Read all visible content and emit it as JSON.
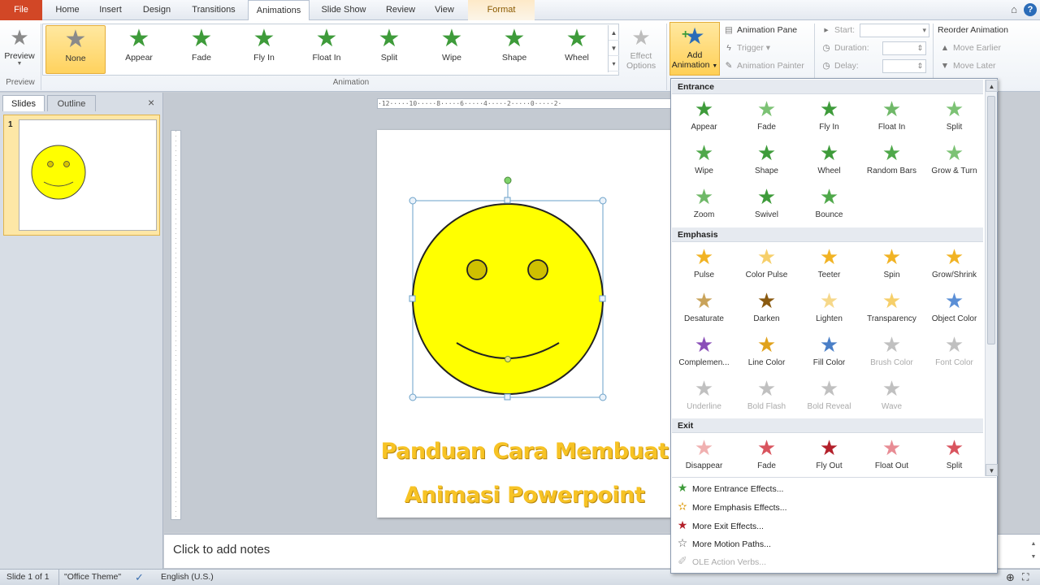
{
  "tabs": {
    "file": "File",
    "home": "Home",
    "insert": "Insert",
    "design": "Design",
    "transitions": "Transitions",
    "animations": "Animations",
    "slide_show": "Slide Show",
    "review": "Review",
    "view": "View",
    "format": "Format"
  },
  "ribbon": {
    "preview": "Preview",
    "preview_group": "Preview",
    "animation_group": "Animation",
    "gallery": [
      {
        "label": "None",
        "icon": "star-gray-icon"
      },
      {
        "label": "Appear",
        "icon": "star-green-icon"
      },
      {
        "label": "Fade",
        "icon": "star-green-icon"
      },
      {
        "label": "Fly In",
        "icon": "star-green-icon"
      },
      {
        "label": "Float In",
        "icon": "star-green-icon"
      },
      {
        "label": "Split",
        "icon": "star-green-icon"
      },
      {
        "label": "Wipe",
        "icon": "star-green-icon"
      },
      {
        "label": "Shape",
        "icon": "star-green-icon"
      },
      {
        "label": "Wheel",
        "icon": "star-green-icon"
      }
    ],
    "effect_options": "Effect Options",
    "add_animation_line1": "Add",
    "add_animation_line2": "Animation",
    "animation_pane": "Animation Pane",
    "trigger": "Trigger",
    "animation_painter": "Animation Painter",
    "start": "Start:",
    "duration": "Duration:",
    "delay": "Delay:",
    "reorder": "Reorder Animation",
    "move_earlier": "Move Earlier",
    "move_later": "Move Later"
  },
  "slides_pane": {
    "tab_slides": "Slides",
    "tab_outline": "Outline",
    "close": "×",
    "slide_number": "1"
  },
  "ruler_text": "·12·····10·····8·····6·····4·····2·····0·····2·",
  "slide": {
    "caption_line1": "Panduan Cara Membuat",
    "caption_line2": "Animasi Powerpoint"
  },
  "notes_placeholder": "Click to add notes",
  "statusbar": {
    "slide_info": "Slide 1 of 1",
    "theme": "\"Office Theme\"",
    "language": "English (U.S.)"
  },
  "dropdown": {
    "entrance_label": "Entrance",
    "emphasis_label": "Emphasis",
    "exit_label": "Exit",
    "entrance": [
      {
        "label": "Appear",
        "color": "#3e9b3a"
      },
      {
        "label": "Fade",
        "color": "#7cc274"
      },
      {
        "label": "Fly In",
        "color": "#3e9b3a"
      },
      {
        "label": "Float In",
        "color": "#6fb868"
      },
      {
        "label": "Split",
        "color": "#7cc274"
      },
      {
        "label": "Wipe",
        "color": "#4fa84a"
      },
      {
        "label": "Shape",
        "color": "#3e9b3a"
      },
      {
        "label": "Wheel",
        "color": "#3e9b3a"
      },
      {
        "label": "Random Bars",
        "color": "#4fa84a"
      },
      {
        "label": "Grow & Turn",
        "color": "#7cc274"
      },
      {
        "label": "Zoom",
        "color": "#6fb868"
      },
      {
        "label": "Swivel",
        "color": "#3e9b3a"
      },
      {
        "label": "Bounce",
        "color": "#4fa84a"
      }
    ],
    "emphasis": [
      {
        "label": "Pulse",
        "color": "#f1b324",
        "disabled": false
      },
      {
        "label": "Color Pulse",
        "color": "#f6cf6a",
        "disabled": false
      },
      {
        "label": "Teeter",
        "color": "#f1b324",
        "disabled": false
      },
      {
        "label": "Spin",
        "color": "#f1b324",
        "disabled": false
      },
      {
        "label": "Grow/Shrink",
        "color": "#f1b324",
        "disabled": false
      },
      {
        "label": "Desaturate",
        "color": "#c9a35a",
        "disabled": false
      },
      {
        "label": "Darken",
        "color": "#8a5a10",
        "disabled": false
      },
      {
        "label": "Lighten",
        "color": "#f6d88a",
        "disabled": false
      },
      {
        "label": "Transparency",
        "color": "#f6cf6a",
        "disabled": false
      },
      {
        "label": "Object Color",
        "color": "#5b8fd6",
        "disabled": false
      },
      {
        "label": "Complemen...",
        "color": "#8a4fb8",
        "disabled": false
      },
      {
        "label": "Line Color",
        "color": "#e0a21c",
        "disabled": false
      },
      {
        "label": "Fill Color",
        "color": "#4a7fc7",
        "disabled": false
      },
      {
        "label": "Brush Color",
        "color": "#c0c0c0",
        "disabled": true
      },
      {
        "label": "Font Color",
        "color": "#c0c0c0",
        "disabled": true
      },
      {
        "label": "Underline",
        "color": "#c0c0c0",
        "disabled": true
      },
      {
        "label": "Bold Flash",
        "color": "#c0c0c0",
        "disabled": true
      },
      {
        "label": "Bold Reveal",
        "color": "#c0c0c0",
        "disabled": true
      },
      {
        "label": "Wave",
        "color": "#c0c0c0",
        "disabled": true
      }
    ],
    "exit": [
      {
        "label": "Disappear",
        "color": "#f0b0b0"
      },
      {
        "label": "Fade",
        "color": "#d9545e"
      },
      {
        "label": "Fly Out",
        "color": "#b3202a"
      },
      {
        "label": "Float Out",
        "color": "#e88c94"
      },
      {
        "label": "Split",
        "color": "#d9545e"
      }
    ],
    "more_entrance": "More Entrance Effects...",
    "more_emphasis": "More Emphasis Effects...",
    "more_exit": "More Exit Effects...",
    "more_motion": "More Motion Paths...",
    "ole_verbs": "OLE Action Verbs..."
  }
}
